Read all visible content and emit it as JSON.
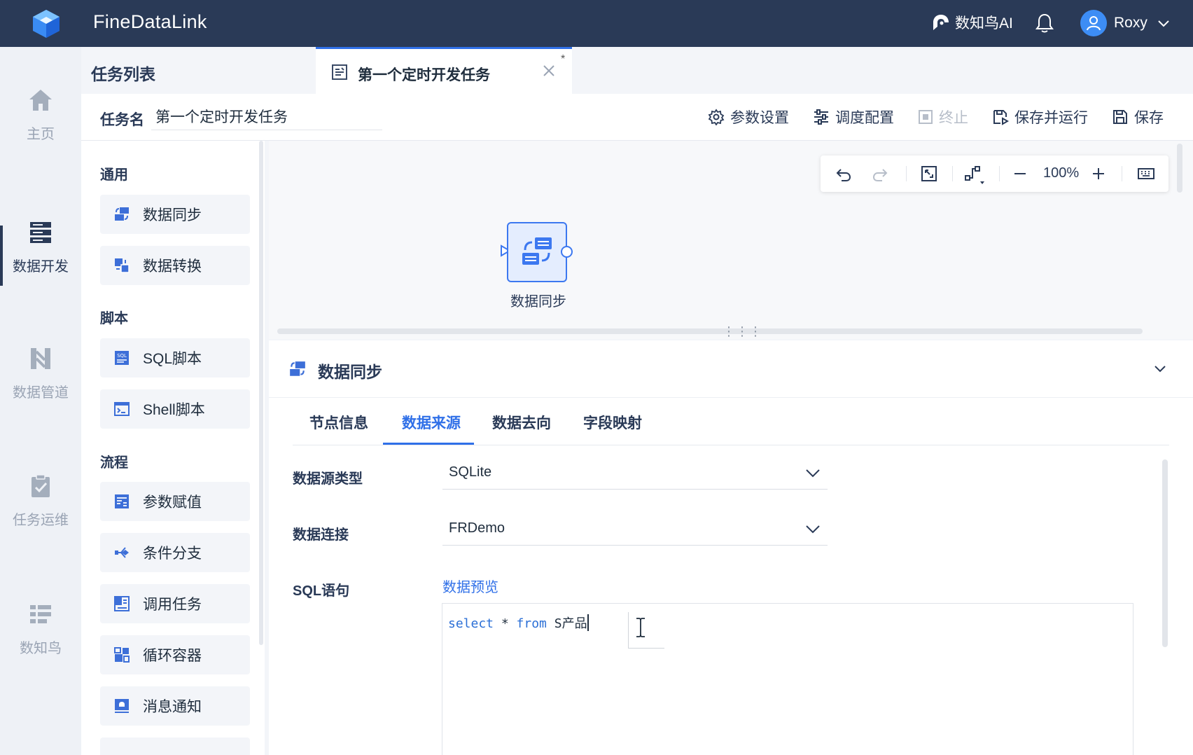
{
  "app": {
    "title": "FineDataLink",
    "ai_label": "数知鸟AI",
    "user_name": "Roxy",
    "brand_color": "#2a3a57",
    "accent_color": "#3070e8"
  },
  "leftnav": {
    "items": [
      {
        "label": "主页",
        "icon": "home-icon"
      },
      {
        "label": "数据开发",
        "icon": "data-dev-icon",
        "active": true
      },
      {
        "label": "数据管道",
        "icon": "data-pipeline-icon"
      },
      {
        "label": "任务运维",
        "icon": "task-ops-icon"
      },
      {
        "label": "数知鸟",
        "icon": "list-icon"
      }
    ]
  },
  "tabstrip": {
    "task_list_title": "任务列表",
    "open_tab": {
      "label": "第一个定时开发任务",
      "modified_marker": "*"
    }
  },
  "taskbar": {
    "name_label": "任务名",
    "name_value": "第一个定时开发任务",
    "actions": {
      "params": "参数设置",
      "schedule": "调度配置",
      "stop": "终止",
      "save_run": "保存并运行",
      "save": "保存"
    }
  },
  "palette": {
    "groups": {
      "general": "通用",
      "script": "脚本",
      "flow": "流程"
    },
    "items": {
      "sync": "数据同步",
      "transform": "数据转换",
      "sql": "SQL脚本",
      "shell": "Shell脚本",
      "param_assign": "参数赋值",
      "branch": "条件分支",
      "call_task": "调用任务",
      "loop": "循环容器",
      "notify": "消息通知"
    }
  },
  "canvas": {
    "zoom": "100%",
    "node_label": "数据同步"
  },
  "props": {
    "title": "数据同步",
    "tabs": [
      "节点信息",
      "数据来源",
      "数据去向",
      "字段映射"
    ],
    "active_tab": "数据来源",
    "source_type_label": "数据源类型",
    "source_type_value": "SQLite",
    "connection_label": "数据连接",
    "connection_value": "FRDemo",
    "sql_label": "SQL语句",
    "preview_link": "数据预览",
    "sql_code": {
      "kw_select": "select",
      "mid": " * ",
      "kw_from": "from",
      "rest": " S产品"
    }
  }
}
